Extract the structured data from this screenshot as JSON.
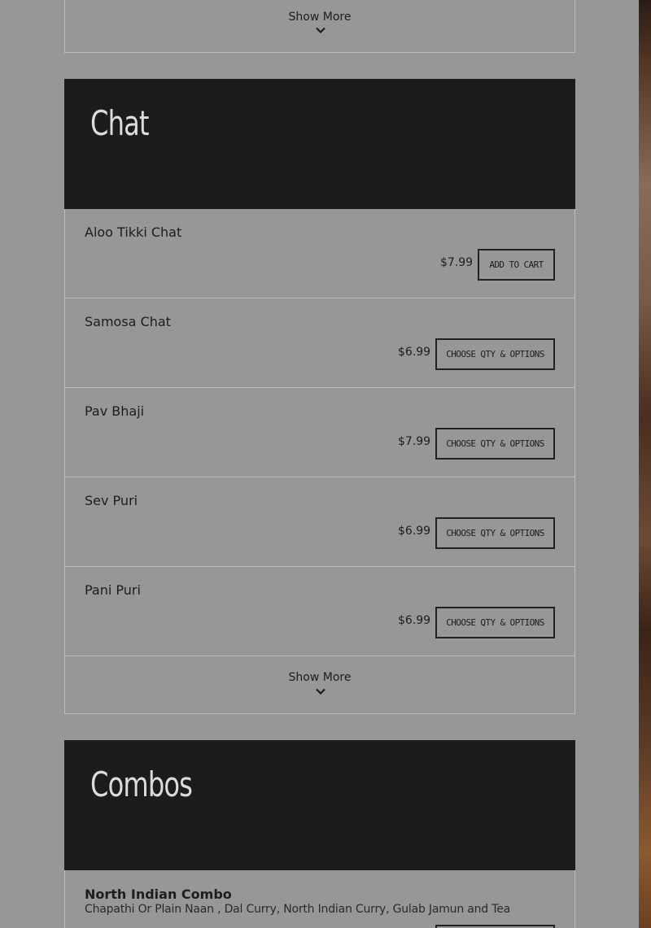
{
  "show_more": {
    "label": "Show More"
  },
  "categories": [
    {
      "title": "Chat",
      "items": [
        {
          "name": "Aloo Tikki Chat",
          "price": "$7.99",
          "button": "ADD TO CART"
        },
        {
          "name": "Samosa Chat",
          "price": "$6.99",
          "button": "CHOOSE QTY & OPTIONS"
        },
        {
          "name": "Pav Bhaji",
          "price": "$7.99",
          "button": "CHOOSE QTY & OPTIONS"
        },
        {
          "name": "Sev Puri",
          "price": "$6.99",
          "button": "CHOOSE QTY & OPTIONS"
        },
        {
          "name": "Pani Puri",
          "price": "$6.99",
          "button": "CHOOSE QTY & OPTIONS"
        }
      ]
    },
    {
      "title": "Combos",
      "items": [
        {
          "name": "North Indian Combo",
          "description": "Chapathi Or Plain Naan , Dal Curry, North Indian Curry, Gulab Jamun and Tea"
        }
      ]
    }
  ]
}
